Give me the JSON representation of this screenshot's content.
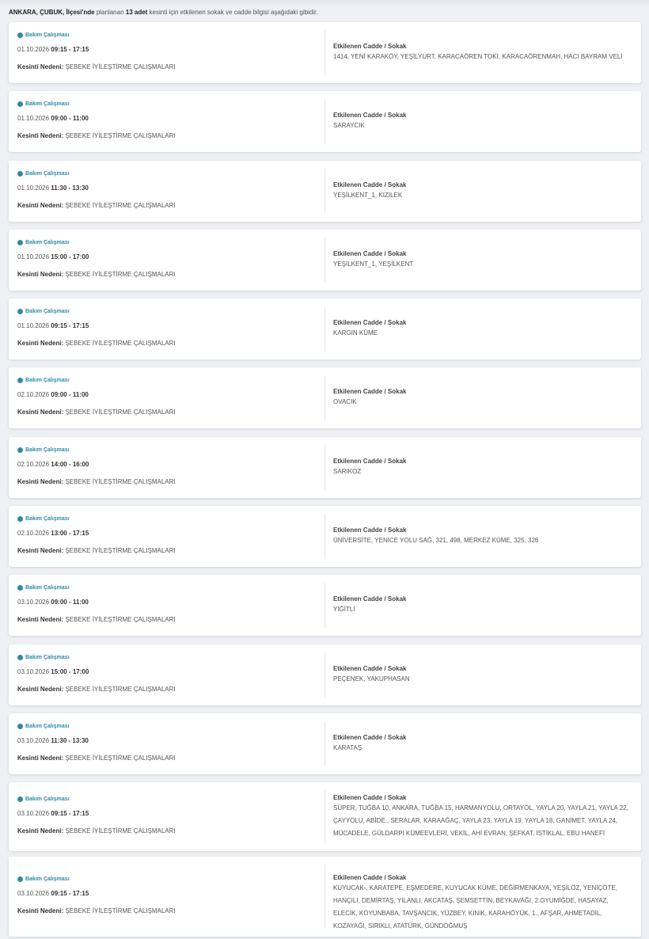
{
  "intro": {
    "location": "ANKARA, ÇUBUK, İlçesi'nde",
    "pre": " planlanan ",
    "count": "13 adet",
    "post": " kesinti için etkilenen sokak ve cadde bilgisi aşağıdaki gibidir."
  },
  "labels": {
    "type": "Bakım Çalışması",
    "reason_label": "Kesinti Nedeni:",
    "streets_label": "Etkilenen Cadde / Sokak"
  },
  "colors": {
    "accent": "#2f89a8",
    "background": "#eef0f3",
    "card": "#ffffff"
  },
  "outages": [
    {
      "date": "01.10.2026",
      "time": "09:15 - 17:15",
      "reason": "ŞEBEKE İYİLEŞTİRME ÇALIŞMALARI",
      "streets": "1414, YENİ KARAKÖY, YEŞİLYURT, KARACAÖREN TOKİ, KARACAÖRENMAH, HACI BAYRAM VELİ"
    },
    {
      "date": "01.10.2026",
      "time": "09:00 - 11:00",
      "reason": "ŞEBEKE İYİLEŞTİRME ÇALIŞMALARI",
      "streets": "SARAYCIK"
    },
    {
      "date": "01.10.2026",
      "time": "11:30 - 13:30",
      "reason": "ŞEBEKE İYİLEŞTİRME ÇALIŞMALARI",
      "streets": "YEŞİLKENT_1, KIZILEK"
    },
    {
      "date": "01.10.2026",
      "time": "15:00 - 17:00",
      "reason": "ŞEBEKE İYİLEŞTİRME ÇALIŞMALARI",
      "streets": "YEŞİLKENT_1, YEŞİLKENT"
    },
    {
      "date": "01.10.2026",
      "time": "09:15 - 17:15",
      "reason": "ŞEBEKE İYİLEŞTİRME ÇALIŞMALARI",
      "streets": "KARGIN KÜME"
    },
    {
      "date": "02.10.2026",
      "time": "09:00 - 11:00",
      "reason": "ŞEBEKE İYİLEŞTİRME ÇALIŞMALARI",
      "streets": "OVACIK"
    },
    {
      "date": "02.10.2026",
      "time": "14:00 - 16:00",
      "reason": "ŞEBEKE İYİLEŞTİRME ÇALIŞMALARI",
      "streets": "SARIKOZ"
    },
    {
      "date": "02.10.2026",
      "time": "13:00 - 17:15",
      "reason": "ŞEBEKE İYİLEŞTİRME ÇALIŞMALARI",
      "streets": "ÜNİVERSİTE, YENİCE YOLU SAĞ, 321, 498, MERKEZ KÜME, 325, 326"
    },
    {
      "date": "03.10.2026",
      "time": "09:00 - 11:00",
      "reason": "ŞEBEKE İYİLEŞTİRME ÇALIŞMALARI",
      "streets": "YİĞİTLİ"
    },
    {
      "date": "03.10.2026",
      "time": "15:00 - 17:00",
      "reason": "ŞEBEKE İYİLEŞTİRME ÇALIŞMALARI",
      "streets": "PEÇENEK, YAKUPHASAN"
    },
    {
      "date": "03.10.2026",
      "time": "11:30 - 13:30",
      "reason": "ŞEBEKE İYİLEŞTİRME ÇALIŞMALARI",
      "streets": "KARATAŞ"
    },
    {
      "date": "03.10.2026",
      "time": "09:15 - 17:15",
      "reason": "ŞEBEKE İYİLEŞTİRME ÇALIŞMALARI",
      "streets": "SÜPER, TUĞBA 10, ANKARA, TUĞBA 15, HARMANYOLU, ORTAYOL, YAYLA 20, YAYLA 21, YAYLA 22, ÇAYYOLU, ABİDE., SERALAR, KARAAĞAÇ, YAYLA 23, YAYLA 19, YAYLA 18, GANİMET, YAYLA 24, MÜCADELE, GÜLDARPI KÜMEEVLERİ, VEKİL, AHİ EVRAN, ŞEFKAT, İSTİKLAL, EBU HANEFİ"
    },
    {
      "date": "03.10.2026",
      "time": "09:15 - 17:15",
      "reason": "ŞEBEKE İYİLEŞTİRME ÇALIŞMALARI",
      "streets": "KUYUCAK-, KARATEPE, EŞMEDERE, KUYUCAK KÜME, DEĞİRMENKAYA, YEŞİLÖZ, YENİÇÖTE, HANÇILI, DEMİRTAŞ, YILANLI, AKCATAŞ, ŞEMSETTİN, BEYKAVAĞI, 2.OYUMİĞDE, HASAYAZ, ELECİK, KOYUNBABA, TAVŞANCIK, YÜZBEY, KINIK, KARAHÖYÜK, 1., AFŞAR, AHMETADİL, KOZAYAĞI, SIRIKLI, ATATÜRK, GÜNDOĞMUŞ"
    }
  ]
}
